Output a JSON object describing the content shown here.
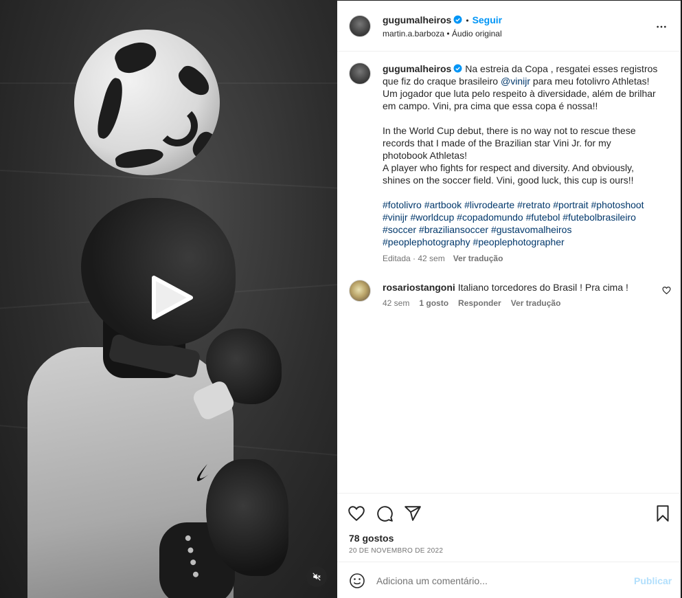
{
  "post": {
    "author": "gugumalheiros",
    "follow_label": "Seguir",
    "dot": "•",
    "audio_credit": "martin.a.barboza • Áudio original"
  },
  "caption": {
    "author": "gugumalheiros",
    "lines_pt": [
      "Na estreia da Copa , resgatei esses registros",
      "que fiz do craque brasileiro ",
      "Um jogador que luta pelo respeito à diversidade, além de brilhar",
      "em campo. Vini, pra cima que essa copa é nossa!!"
    ],
    "mention": "@vinijr",
    "mention_after": " para meu fotolivro Athletas!",
    "lines_en": [
      "In the World Cup debut, there is no way not to rescue these",
      "records that I made of the Brazilian star Vini Jr. for my",
      "photobook Athletas!",
      "A player who fights for respect and diversity. And obviously,",
      "shines on the soccer field. Vini, good luck, this cup is ours!!"
    ],
    "hashtag_lines": [
      "#fotolivro #artbook #livrodearte #retrato #portrait #photoshoot",
      "#vinijr #worldcup #copadomundo #futebol #futebolbrasileiro",
      "#soccer #braziliansoccer #gustavomalheiros",
      "#peoplephotography #peoplephotographer"
    ],
    "edited_time": "Editada · 42 sem",
    "see_translation": "Ver tradução"
  },
  "comment": {
    "author": "rosariostangoni",
    "text": "Italiano torcedores do Brasil ! Pra cima !",
    "time": "42 sem",
    "likes": "1 gosto",
    "reply": "Responder",
    "see_translation": "Ver tradução"
  },
  "footer": {
    "likes": "78 gostos",
    "date": "20 DE NOVEMBRO DE 2022",
    "comment_placeholder": "Adiciona um comentário...",
    "publish": "Publicar"
  },
  "icons": {
    "verified": "verified-badge-icon",
    "more": "more-options-icon",
    "like": "heart-icon",
    "comment": "comment-icon",
    "share": "share-icon",
    "save": "bookmark-icon",
    "emoji": "emoji-icon",
    "play": "play-icon",
    "mute": "mute-icon"
  },
  "colors": {
    "link": "#0095f6",
    "hashtag": "#00376b",
    "muted": "#737373",
    "publish_disabled": "#b2dffc"
  }
}
